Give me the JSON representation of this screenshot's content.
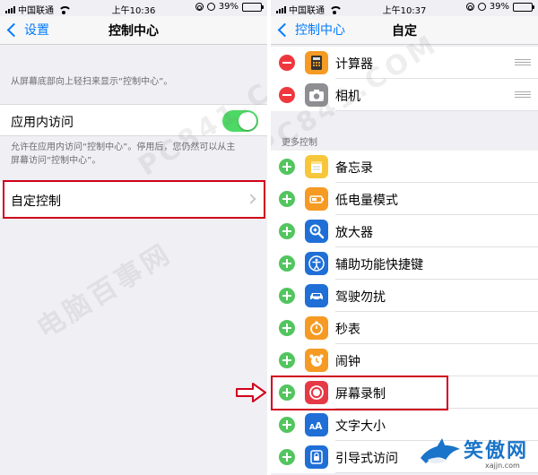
{
  "left": {
    "status": {
      "carrier": "中国联通",
      "time": "上午10:36",
      "battery": "39%",
      "battery_level": 0.39
    },
    "nav": {
      "back_label": "设置",
      "title": "控制中心"
    },
    "intro_text": "从屏幕底部向上轻扫来显示“控制中心”。",
    "in_app_access": {
      "label": "应用内访问",
      "enabled": true
    },
    "in_app_note": [
      "允许在应用内访问“控制中心”。停用后，您仍然可以从主",
      "屏幕访问“控制中心”。"
    ],
    "customize_label": "自定控制"
  },
  "right": {
    "status": {
      "carrier": "中国联通",
      "time": "上午10:37",
      "battery": "39%",
      "battery_level": 0.39
    },
    "nav": {
      "back_label": "控制中心",
      "title": "自定"
    },
    "included": [
      {
        "label": "计算器",
        "icon": "calculator-icon"
      },
      {
        "label": "相机",
        "icon": "camera-icon"
      }
    ],
    "more_header": "更多控制",
    "more": [
      {
        "label": "备忘录",
        "icon": "notes-icon"
      },
      {
        "label": "低电量模式",
        "icon": "battery-icon"
      },
      {
        "label": "放大器",
        "icon": "magnifier-icon"
      },
      {
        "label": "辅助功能快捷键",
        "icon": "accessibility-icon"
      },
      {
        "label": "驾驶勿扰",
        "icon": "car-icon"
      },
      {
        "label": "秒表",
        "icon": "stopwatch-icon"
      },
      {
        "label": "闹钟",
        "icon": "alarm-clock-icon"
      },
      {
        "label": "屏幕录制",
        "icon": "screen-record-icon"
      },
      {
        "label": "文字大小",
        "icon": "text-size-icon"
      },
      {
        "label": "引导式访问",
        "icon": "lock-icon"
      }
    ]
  },
  "watermarks": [
    "PC841.COM",
    "电脑百事网"
  ],
  "logo": {
    "text": "笑傲网",
    "url": "xajjn.com"
  },
  "colors": {
    "accent": "#007aff",
    "toggle_on": "#4cd964",
    "remove": "#f0373e",
    "add": "#53c55f",
    "highlight": "#d0021b"
  }
}
